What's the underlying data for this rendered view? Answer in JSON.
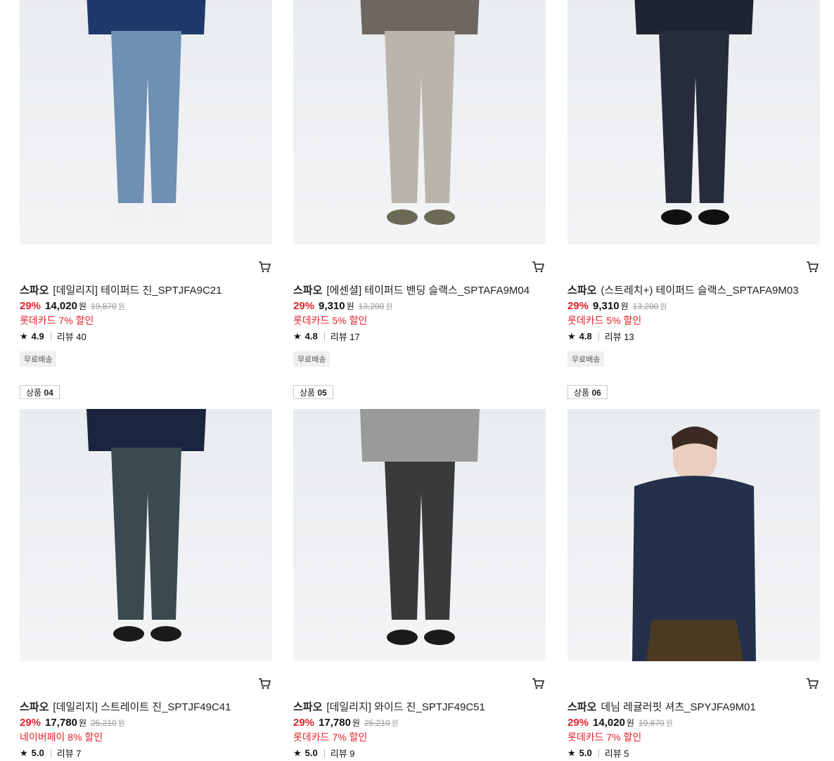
{
  "products": [
    {
      "rank_prefix": "",
      "rank_num": "",
      "brand": "스파오",
      "name": "[데일리지] 테이퍼드 진_SPTJFA9C21",
      "discount": "29%",
      "price": "14,020",
      "won": "원",
      "original": "19,870",
      "original_won": "원",
      "promo": "롯데카드 7% 할인",
      "rating": "4.9",
      "reviews": "리뷰 40",
      "shipping": "무료배송",
      "colors": {
        "top": "#1f3a6a",
        "bottom": "#6f8fb3",
        "shoes": "#f2f2f2"
      }
    },
    {
      "rank_prefix": "",
      "rank_num": "",
      "brand": "스파오",
      "name": "[에센셜] 테이퍼드 밴딩 슬랙스_SPTAFA9M04",
      "discount": "29%",
      "price": "9,310",
      "won": "원",
      "original": "13,200",
      "original_won": "원",
      "promo": "롯데카드 5% 할인",
      "rating": "4.8",
      "reviews": "리뷰 17",
      "shipping": "무료배송",
      "colors": {
        "top": "#6e6660",
        "bottom": "#b9b5ac",
        "shoes": "#6b6a56"
      }
    },
    {
      "rank_prefix": "",
      "rank_num": "",
      "brand": "스파오",
      "name": "(스트레치+) 테이퍼드 슬랙스_SPTAFA9M03",
      "discount": "29%",
      "price": "9,310",
      "won": "원",
      "original": "13,200",
      "original_won": "원",
      "promo": "롯데카드 5% 할인",
      "rating": "4.8",
      "reviews": "리뷰 13",
      "shipping": "무료배송",
      "colors": {
        "top": "#1e2430",
        "bottom": "#262c3a",
        "shoes": "#111111"
      }
    },
    {
      "rank_prefix": "상품",
      "rank_num": "04",
      "brand": "스파오",
      "name": "[데일리지] 스트레이트 진_SPTJF49C41",
      "discount": "29%",
      "price": "17,780",
      "won": "원",
      "original": "25,210",
      "original_won": "원",
      "promo": "네이버페이 8% 할인",
      "rating": "5.0",
      "reviews": "리뷰 7",
      "shipping": "",
      "colors": {
        "top": "#1c2540",
        "bottom": "#3b4a50",
        "shoes": "#1a1a1a"
      }
    },
    {
      "rank_prefix": "상품",
      "rank_num": "05",
      "brand": "스파오",
      "name": "[데일리지] 와이드 진_SPTJF49C51",
      "discount": "29%",
      "price": "17,780",
      "won": "원",
      "original": "25,210",
      "original_won": "원",
      "promo": "롯데카드 7% 할인",
      "rating": "5.0",
      "reviews": "리뷰 9",
      "shipping": "",
      "colors": {
        "top": "#9a9a9a",
        "bottom": "#3a3a3c",
        "shoes": "#1a1a1a"
      }
    },
    {
      "rank_prefix": "상품",
      "rank_num": "06",
      "brand": "스파오",
      "name": "데님 레귤러핏 셔츠_SPYJFA9M01",
      "discount": "29%",
      "price": "14,020",
      "won": "원",
      "original": "19,870",
      "original_won": "원",
      "promo": "롯데카드 7% 할인",
      "rating": "5.0",
      "reviews": "리뷰 5",
      "shipping": "",
      "colors": {
        "top": "#24304a",
        "bottom": "#4a3a22",
        "shoes": "#6b4f35"
      }
    }
  ]
}
